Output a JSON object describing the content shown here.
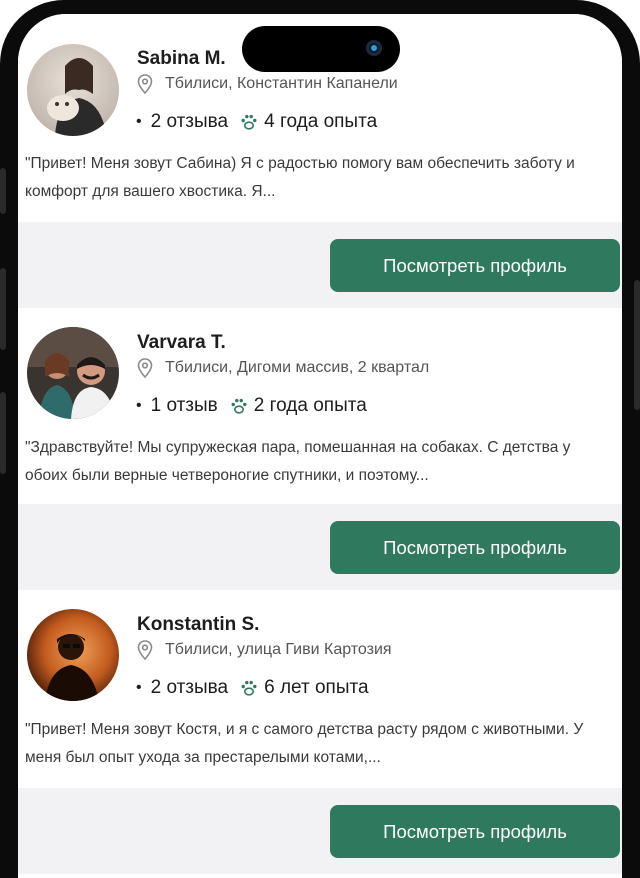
{
  "colors": {
    "accent": "#2f7a5e",
    "footer_bg": "#f2f2f5",
    "text_primary": "#1d1d1d",
    "text_secondary": "#555555"
  },
  "icons": {
    "location": "map-pin-icon",
    "experience": "paw-icon",
    "bullet": "bullet-dot"
  },
  "cards": [
    {
      "name": "Sabina M.",
      "location": "Тбилиси, Константин Капанели",
      "reviews": "2 отзыва",
      "experience": "4 года опыта",
      "description": "\"Привет! Меня зовут Сабина) Я с радостью помогу вам обеспечить заботу и комфорт для вашего хвостика. Я...",
      "button_label": "Посмотреть профиль"
    },
    {
      "name": "Varvara T.",
      "location": "Тбилиси, Дигоми массив, 2 квартал",
      "reviews": "1 отзыв",
      "experience": "2 года опыта",
      "description": "\"Здравствуйте! Мы супружеская пара, помешанная на собаках. С детства у обоих были верные четвероногие спутники, и поэтому...",
      "button_label": "Посмотреть профиль"
    },
    {
      "name": "Konstantin S.",
      "location": "Тбилиси, улица Гиви Картозия",
      "reviews": "2 отзыва",
      "experience": "6 лет опыта",
      "description": "\"Привет! Меня зовут Костя, и я с самого детства расту рядом с животными. У меня был опыт ухода за престарелыми котами,...",
      "button_label": "Посмотреть профиль"
    }
  ]
}
